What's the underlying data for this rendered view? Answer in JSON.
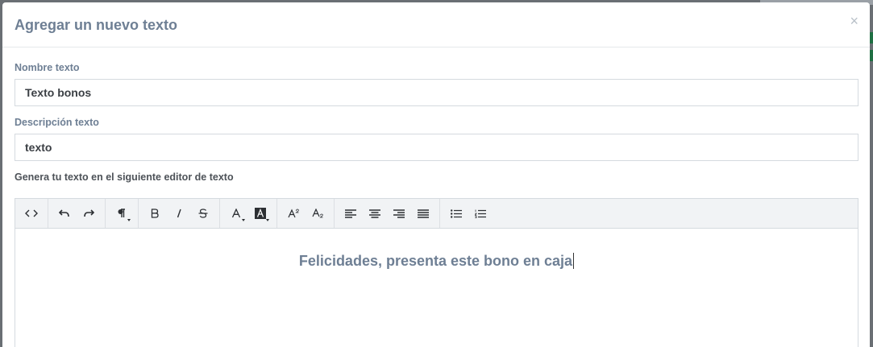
{
  "modal": {
    "title": "Agregar un nuevo texto",
    "close_symbol": "×"
  },
  "form": {
    "name_label": "Nombre texto",
    "name_value": "Texto bonos",
    "description_label": "Descripción texto",
    "description_value": "texto",
    "editor_hint": "Genera tu texto en el siguiente editor de texto"
  },
  "editor": {
    "content": "Felicidades, presenta este bono en caja",
    "toolbar_icons": [
      "code-view-icon",
      "undo-icon",
      "redo-icon",
      "paragraph-icon",
      "bold-icon",
      "italic-icon",
      "strikethrough-icon",
      "font-color-icon",
      "highlight-color-icon",
      "superscript-icon",
      "subscript-icon",
      "align-left-icon",
      "align-center-icon",
      "align-right-icon",
      "align-justify-icon",
      "bullet-list-icon",
      "numbered-list-icon"
    ]
  },
  "colors": {
    "label": "#6e7f94",
    "border": "#d5dadf",
    "toolbar_bg": "#f1f3f5"
  }
}
